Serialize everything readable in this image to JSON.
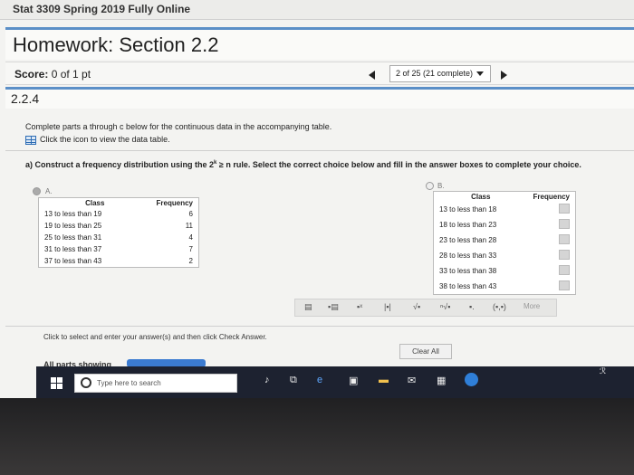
{
  "course": {
    "title": "Stat 3309 Spring 2019 Fully Online"
  },
  "homework": {
    "title": "Homework: Section 2.2"
  },
  "score": {
    "label": "Score:",
    "value": "0 of 1 pt"
  },
  "nav": {
    "position": "2 of 25 (21 complete)"
  },
  "question": {
    "number": "2.2.4",
    "instructions": "Complete parts a through c below for the continuous data in the accompanying table.",
    "data_link": "Click the icon to view the data table.",
    "part_a_prefix": "a) Construct a frequency distribution using the 2",
    "part_a_sup": "k",
    "part_a_suffix": " ≥ n rule. Select the correct choice below and fill in the answer boxes to complete your choice."
  },
  "option_a": {
    "label": "A.",
    "headers": [
      "Class",
      "Frequency"
    ],
    "rows": [
      {
        "class": "13 to less than 19",
        "freq": "6"
      },
      {
        "class": "19 to less than 25",
        "freq": "11"
      },
      {
        "class": "25 to less than 31",
        "freq": "4"
      },
      {
        "class": "31 to less than 37",
        "freq": "7"
      },
      {
        "class": "37 to less than 43",
        "freq": "2"
      }
    ]
  },
  "option_b": {
    "label": "B.",
    "headers": [
      "Class",
      "Frequency"
    ],
    "rows": [
      {
        "class": "13 to less than 18"
      },
      {
        "class": "18 to less than 23"
      },
      {
        "class": "23 to less than 28"
      },
      {
        "class": "28 to less than 33"
      },
      {
        "class": "33 to less than 38"
      },
      {
        "class": "38 to less than 43"
      }
    ]
  },
  "toolbar": {
    "icons": [
      "fraction-icon",
      "mixed-number-icon",
      "exponent-icon",
      "absolute-value-icon",
      "sqrt-icon",
      "nth-root-icon",
      "decimal-icon",
      "interval-icon"
    ],
    "more_label": "More"
  },
  "footer": {
    "click_text": "Click to select and enter your answer(s) and then click Check Answer.",
    "clear_all": "Clear All",
    "all_parts": "All parts showing"
  },
  "taskbar": {
    "search_placeholder": "Type here to search"
  }
}
